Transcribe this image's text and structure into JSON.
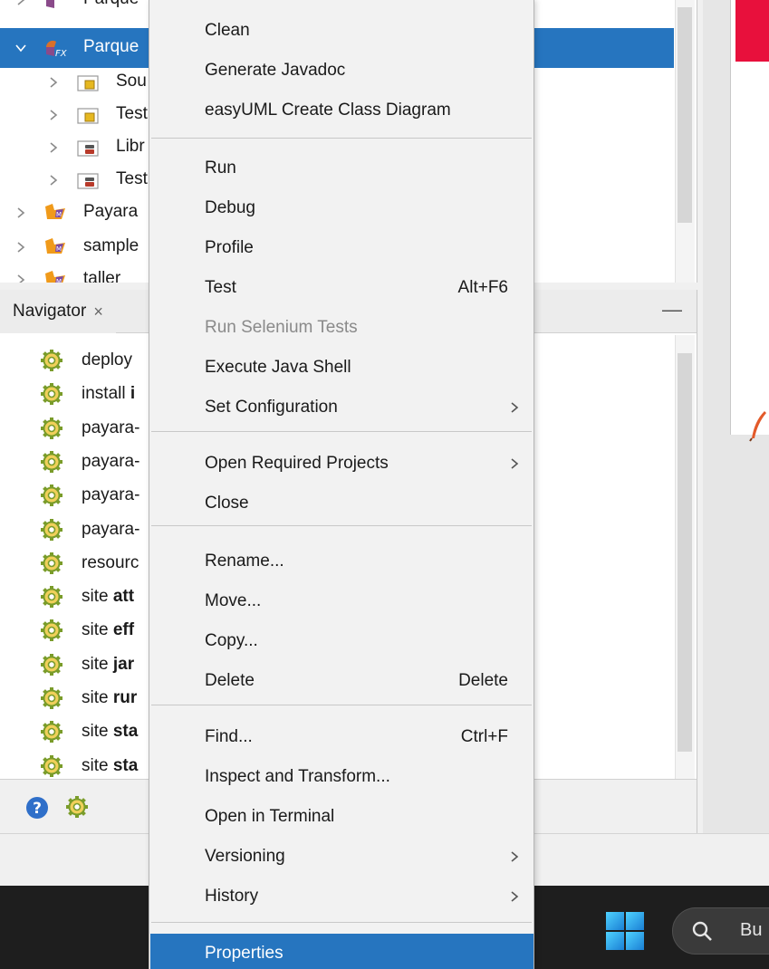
{
  "tree": {
    "rows": [
      {
        "label": "Parque",
        "icon": "javafx-project-icon"
      },
      {
        "label": "Parque",
        "icon": "javafx-project-icon"
      },
      {
        "label": "Sou",
        "icon": "package-folder-icon"
      },
      {
        "label": "Test",
        "icon": "package-folder-icon"
      },
      {
        "label": "Libr",
        "icon": "library-folder-icon"
      },
      {
        "label": "Test",
        "icon": "library-folder-icon"
      },
      {
        "label": "Payara",
        "icon": "maven-project-icon"
      },
      {
        "label": "sample",
        "icon": "maven-project-icon"
      },
      {
        "label": "taller",
        "icon": "maven-project-icon"
      }
    ]
  },
  "navigator": {
    "tab_label": "Navigator",
    "close_glyph": "×",
    "minimize_glyph": "—",
    "items": [
      {
        "prefix": "deploy",
        "bold": ""
      },
      {
        "prefix": "install ",
        "bold": "i"
      },
      {
        "prefix": "payara-",
        "bold": ""
      },
      {
        "prefix": "payara-",
        "bold": ""
      },
      {
        "prefix": "payara-",
        "bold": ""
      },
      {
        "prefix": "payara-",
        "bold": ""
      },
      {
        "prefix": "resourc",
        "bold": ""
      },
      {
        "prefix": "site ",
        "bold": "att"
      },
      {
        "prefix": "site ",
        "bold": "eff"
      },
      {
        "prefix": "site ",
        "bold": "jar"
      },
      {
        "prefix": "site ",
        "bold": "rur"
      },
      {
        "prefix": "site ",
        "bold": "sta"
      },
      {
        "prefix": "site ",
        "bold": "sta"
      }
    ]
  },
  "context_menu": {
    "items": [
      {
        "label": "Clean",
        "shortcut": "",
        "submenu": false,
        "disabled": false,
        "highlighted": false
      },
      {
        "label": "Generate Javadoc",
        "shortcut": "",
        "submenu": false,
        "disabled": false,
        "highlighted": false
      },
      {
        "label": "easyUML Create Class Diagram",
        "shortcut": "",
        "submenu": false,
        "disabled": false,
        "highlighted": false
      },
      {
        "label": "Run",
        "shortcut": "",
        "submenu": false,
        "disabled": false,
        "highlighted": false
      },
      {
        "label": "Debug",
        "shortcut": "",
        "submenu": false,
        "disabled": false,
        "highlighted": false
      },
      {
        "label": "Profile",
        "shortcut": "",
        "submenu": false,
        "disabled": false,
        "highlighted": false
      },
      {
        "label": "Test",
        "shortcut": "Alt+F6",
        "submenu": false,
        "disabled": false,
        "highlighted": false
      },
      {
        "label": "Run Selenium Tests",
        "shortcut": "",
        "submenu": false,
        "disabled": true,
        "highlighted": false
      },
      {
        "label": "Execute Java Shell",
        "shortcut": "",
        "submenu": false,
        "disabled": false,
        "highlighted": false
      },
      {
        "label": "Set Configuration",
        "shortcut": "",
        "submenu": true,
        "disabled": false,
        "highlighted": false
      },
      {
        "label": "Open Required Projects",
        "shortcut": "",
        "submenu": true,
        "disabled": false,
        "highlighted": false
      },
      {
        "label": "Close",
        "shortcut": "",
        "submenu": false,
        "disabled": false,
        "highlighted": false
      },
      {
        "label": "Rename...",
        "shortcut": "",
        "submenu": false,
        "disabled": false,
        "highlighted": false
      },
      {
        "label": "Move...",
        "shortcut": "",
        "submenu": false,
        "disabled": false,
        "highlighted": false
      },
      {
        "label": "Copy...",
        "shortcut": "",
        "submenu": false,
        "disabled": false,
        "highlighted": false
      },
      {
        "label": "Delete",
        "shortcut": "Delete",
        "submenu": false,
        "disabled": false,
        "highlighted": false
      },
      {
        "label": "Find...",
        "shortcut": "Ctrl+F",
        "submenu": false,
        "disabled": false,
        "highlighted": false
      },
      {
        "label": "Inspect and Transform...",
        "shortcut": "",
        "submenu": false,
        "disabled": false,
        "highlighted": false
      },
      {
        "label": "Open in Terminal",
        "shortcut": "",
        "submenu": false,
        "disabled": false,
        "highlighted": false
      },
      {
        "label": "Versioning",
        "shortcut": "",
        "submenu": true,
        "disabled": false,
        "highlighted": false
      },
      {
        "label": "History",
        "shortcut": "",
        "submenu": true,
        "disabled": false,
        "highlighted": false
      },
      {
        "label": "Properties",
        "shortcut": "",
        "submenu": false,
        "disabled": false,
        "highlighted": true
      }
    ]
  },
  "taskbar": {
    "search_text": "Bu"
  },
  "colors": {
    "selection": "#2675bf",
    "editor_accent": "#e8103c",
    "taskbar": "#1e1e1e"
  }
}
